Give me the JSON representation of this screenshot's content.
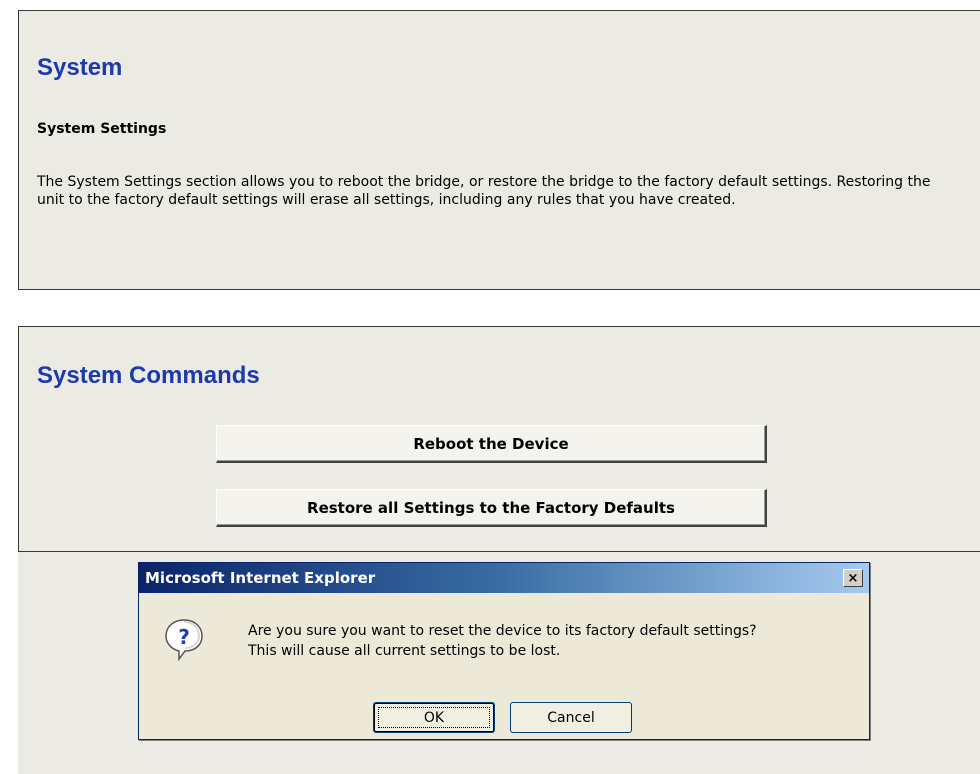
{
  "system_panel": {
    "title": "System",
    "subheading": "System Settings",
    "description": "The System Settings section allows you to reboot the bridge, or restore the bridge to the factory default settings. Restoring the unit to the factory default settings will erase all settings, including any rules that you have created."
  },
  "commands_panel": {
    "title": "System Commands",
    "reboot_label": "Reboot the Device",
    "restore_label": "Restore all Settings to the Factory Defaults"
  },
  "dialog": {
    "title": "Microsoft Internet Explorer",
    "close_symbol": "×",
    "icon": "question-icon",
    "message_line1": "Are you sure you want to reset the device to its factory default settings?",
    "message_line2": "This will cause all current settings to be lost.",
    "ok_label": "OK",
    "cancel_label": "Cancel"
  },
  "colors": {
    "section_title": "#1c3aa9",
    "panel_background": "#ecebe3",
    "titlebar_start": "#0a246a",
    "titlebar_end": "#a6caf0"
  }
}
